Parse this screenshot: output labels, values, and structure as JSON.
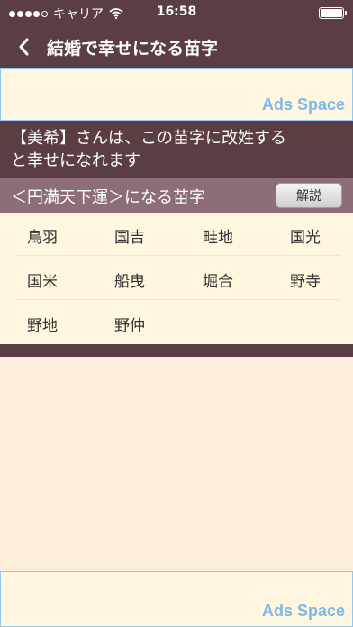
{
  "status_bar": {
    "carrier": "キャリア",
    "time": "16:58"
  },
  "nav": {
    "title": "結婚で幸せになる苗字",
    "back_glyph": "＜"
  },
  "ads": {
    "top_label": "Ads Space",
    "bottom_label": "Ads Space"
  },
  "message": {
    "line1": "【美希】さんは、この苗字に改姓する",
    "line2": "と幸せになれます"
  },
  "section": {
    "title": "＜円満天下運＞になる苗字",
    "explain_button": "解説"
  },
  "surnames": [
    [
      "鳥羽",
      "国吉",
      "畦地",
      "国光"
    ],
    [
      "国米",
      "船曳",
      "堀合",
      "野寺"
    ],
    [
      "野地",
      "野仲"
    ]
  ],
  "colors": {
    "header_bg": "#5a3e44",
    "section_bg": "#8c6d78",
    "page_bg": "#fdeedc",
    "ad_text": "#7cb9ea"
  }
}
